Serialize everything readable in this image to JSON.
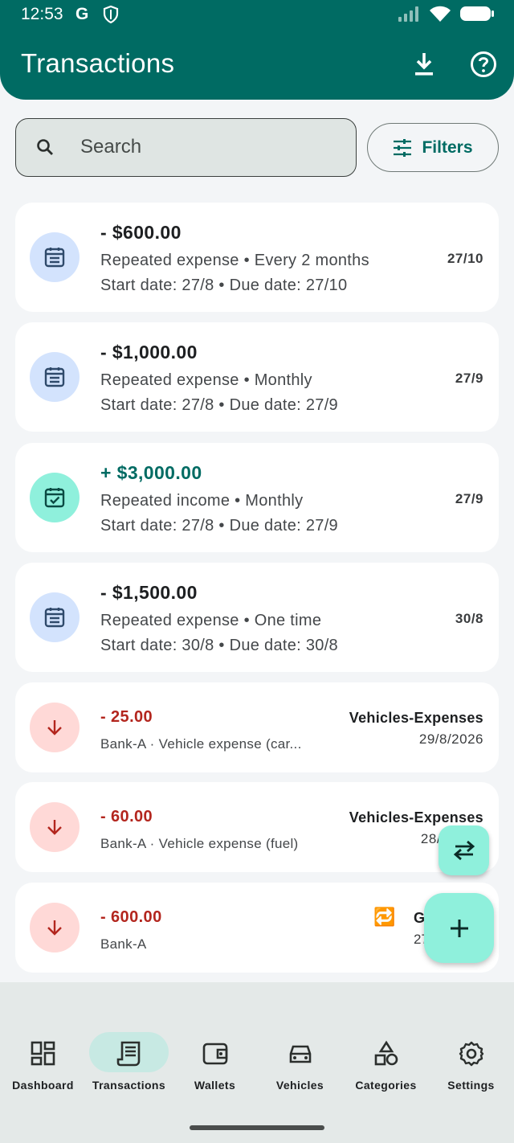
{
  "status": {
    "time": "12:53",
    "g": "G"
  },
  "header": {
    "title": "Transactions"
  },
  "search": {
    "placeholder": "Search",
    "filters_label": "Filters"
  },
  "repeated": [
    {
      "amount": "- $600.00",
      "line1": "Repeated expense • Every 2 months",
      "line2": "Start date: 27/8 • Due date: 27/10",
      "date": "27/10",
      "kind": "expense"
    },
    {
      "amount": "- $1,000.00",
      "line1": "Repeated expense • Monthly",
      "line2": "Start date: 27/8 • Due date: 27/9",
      "date": "27/9",
      "kind": "expense"
    },
    {
      "amount": "+ $3,000.00",
      "line1": "Repeated income • Monthly",
      "line2": "Start date: 27/8 • Due date: 27/9",
      "date": "27/9",
      "kind": "income"
    },
    {
      "amount": "- $1,500.00",
      "line1": "Repeated expense • One time",
      "line2": "Start date: 30/8 • Due date: 30/8",
      "date": "30/8",
      "kind": "expense"
    }
  ],
  "transactions": [
    {
      "amount": "- 25.00",
      "wallet": "Bank-A",
      "note": "Vehicle expense (car...",
      "category": "Vehicles-Expenses",
      "date": "29/8/2026"
    },
    {
      "amount": "- 60.00",
      "wallet": "Bank-A",
      "note": "Vehicle expense (fuel)",
      "category": "Vehicles-Expenses",
      "date": "28/8"
    },
    {
      "amount": "- 600.00",
      "wallet": "Bank-A",
      "note": "",
      "category": "G",
      "date": "27",
      "badge": "🔁"
    }
  ],
  "nav": [
    {
      "label": "Dashboard",
      "icon": "dashboard-icon"
    },
    {
      "label": "Transactions",
      "icon": "receipt-icon",
      "active": true
    },
    {
      "label": "Wallets",
      "icon": "wallet-icon"
    },
    {
      "label": "Vehicles",
      "icon": "car-icon"
    },
    {
      "label": "Categories",
      "icon": "categories-icon"
    },
    {
      "label": "Settings",
      "icon": "gear-icon"
    }
  ],
  "colors": {
    "primary": "#006b63",
    "expense": "#b3261e",
    "fab": "#8ff0dc"
  }
}
